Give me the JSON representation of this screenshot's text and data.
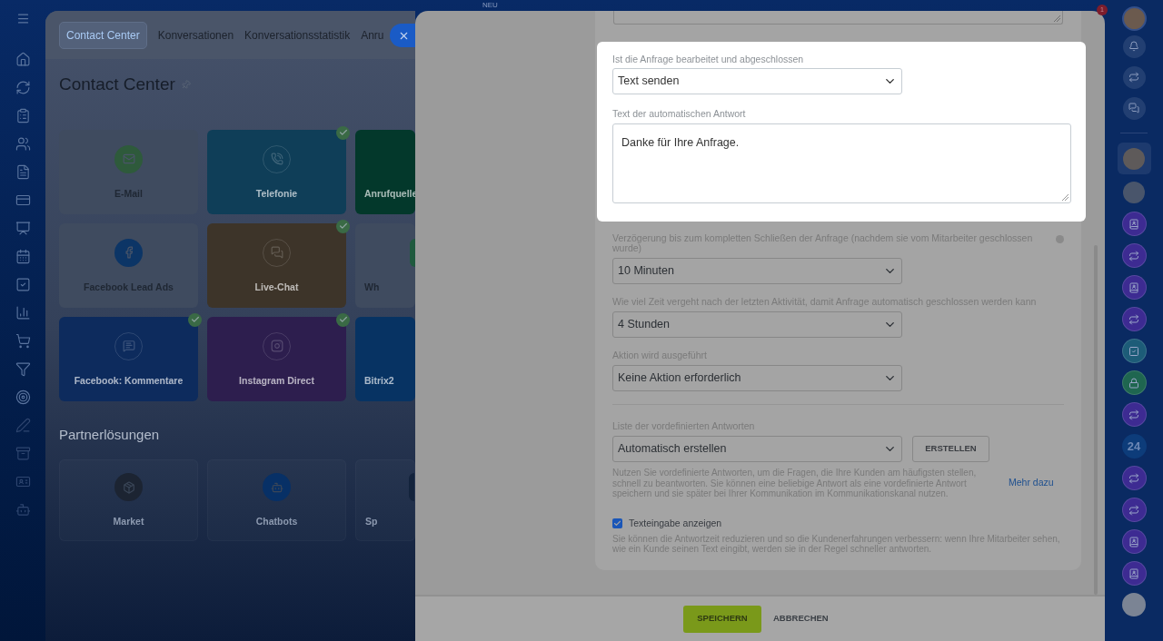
{
  "top_bar": {
    "label": "NEU",
    "notification_count": "1"
  },
  "background_page": {
    "tabs": [
      {
        "label": "Contact Center",
        "selected": true
      },
      {
        "label": "Konversationen",
        "selected": false
      },
      {
        "label": "Konversationsstatistik",
        "selected": false
      },
      {
        "label": "Anru",
        "selected": false
      }
    ],
    "title": "Contact Center",
    "tiles": [
      {
        "label": "E-Mail",
        "kind": "plain",
        "color": "#2e5a3b",
        "connected": false
      },
      {
        "label": "Telefonie",
        "kind": "colored",
        "color": "#0f3e58",
        "connected": true
      },
      {
        "label": "Anrufquelle",
        "kind": "colored",
        "color": "#03382b",
        "connected": false
      },
      {
        "label": "Facebook Lead Ads",
        "kind": "plain",
        "color": "#0c3566",
        "connected": false
      },
      {
        "label": "Live-Chat",
        "kind": "colored",
        "color": "#3d3429",
        "connected": true
      },
      {
        "label": "Wh",
        "kind": "plain",
        "color": "#1f5a3e",
        "connected": false
      },
      {
        "label": "Facebook: Kommentare",
        "kind": "colored",
        "color": "#0d2b5d",
        "connected": true
      },
      {
        "label": "Instagram Direct",
        "kind": "colored",
        "color": "#2d1e4e",
        "connected": true
      },
      {
        "label": "Bitrix2",
        "kind": "colored",
        "color": "#073363",
        "connected": false
      }
    ],
    "partner_heading": "Partnerlösungen",
    "partner_tiles": [
      {
        "label": "Market",
        "color": "#1c2432"
      },
      {
        "label": "Chatbots",
        "color": "#073066"
      },
      {
        "label": "Sp",
        "color": "#13233c"
      }
    ]
  },
  "slider": {
    "highlighted": {
      "select_label": "Ist die Anfrage bearbeitet und abgeschlossen",
      "select_value": "Text senden",
      "text_label": "Text der automatischen Antwort",
      "text_value": "Danke für Ihre Anfrage."
    },
    "fields": [
      {
        "label": "Verzögerung bis zum kompletten Schließen der Anfrage (nachdem sie vom Mitarbeiter geschlossen wurde)",
        "value": "10 Minuten",
        "help": true
      },
      {
        "label": "Wie viel Zeit vergeht nach der letzten Aktivität, damit Anfrage automatisch geschlossen werden kann",
        "value": "4 Stunden",
        "help": false
      },
      {
        "label": "Aktion wird ausgeführt",
        "value": "Keine Aktion erforderlich",
        "help": false
      }
    ],
    "predefined": {
      "label": "Liste der vordefinierten Antworten",
      "value": "Automatisch erstellen",
      "button": "ERSTELLEN",
      "description": "Nutzen Sie vordefinierte Antworten, um die Fragen, die Ihre Kunden am häufigsten stellen, schnell zu beantworten. Sie können eine beliebige Antwort als eine vordefinierte Antwort speichern und sie später bei Ihrer Kommunikation im Kommunikationskanal nutzen.",
      "link": "Mehr dazu"
    },
    "checkbox": {
      "label": "Texteingabe anzeigen",
      "checked": true,
      "description": "Sie können die Antwortzeit reduzieren und so die Kundenerfahrungen verbessern: wenn Ihre Mitarbeiter sehen, wie ein Kunde seinen Text eingibt, werden sie in der Regel schneller antworten."
    },
    "footer": {
      "save": "SPEICHERN",
      "cancel": "ABBRECHEN"
    }
  },
  "right_sidebar": {
    "counter": "24"
  }
}
